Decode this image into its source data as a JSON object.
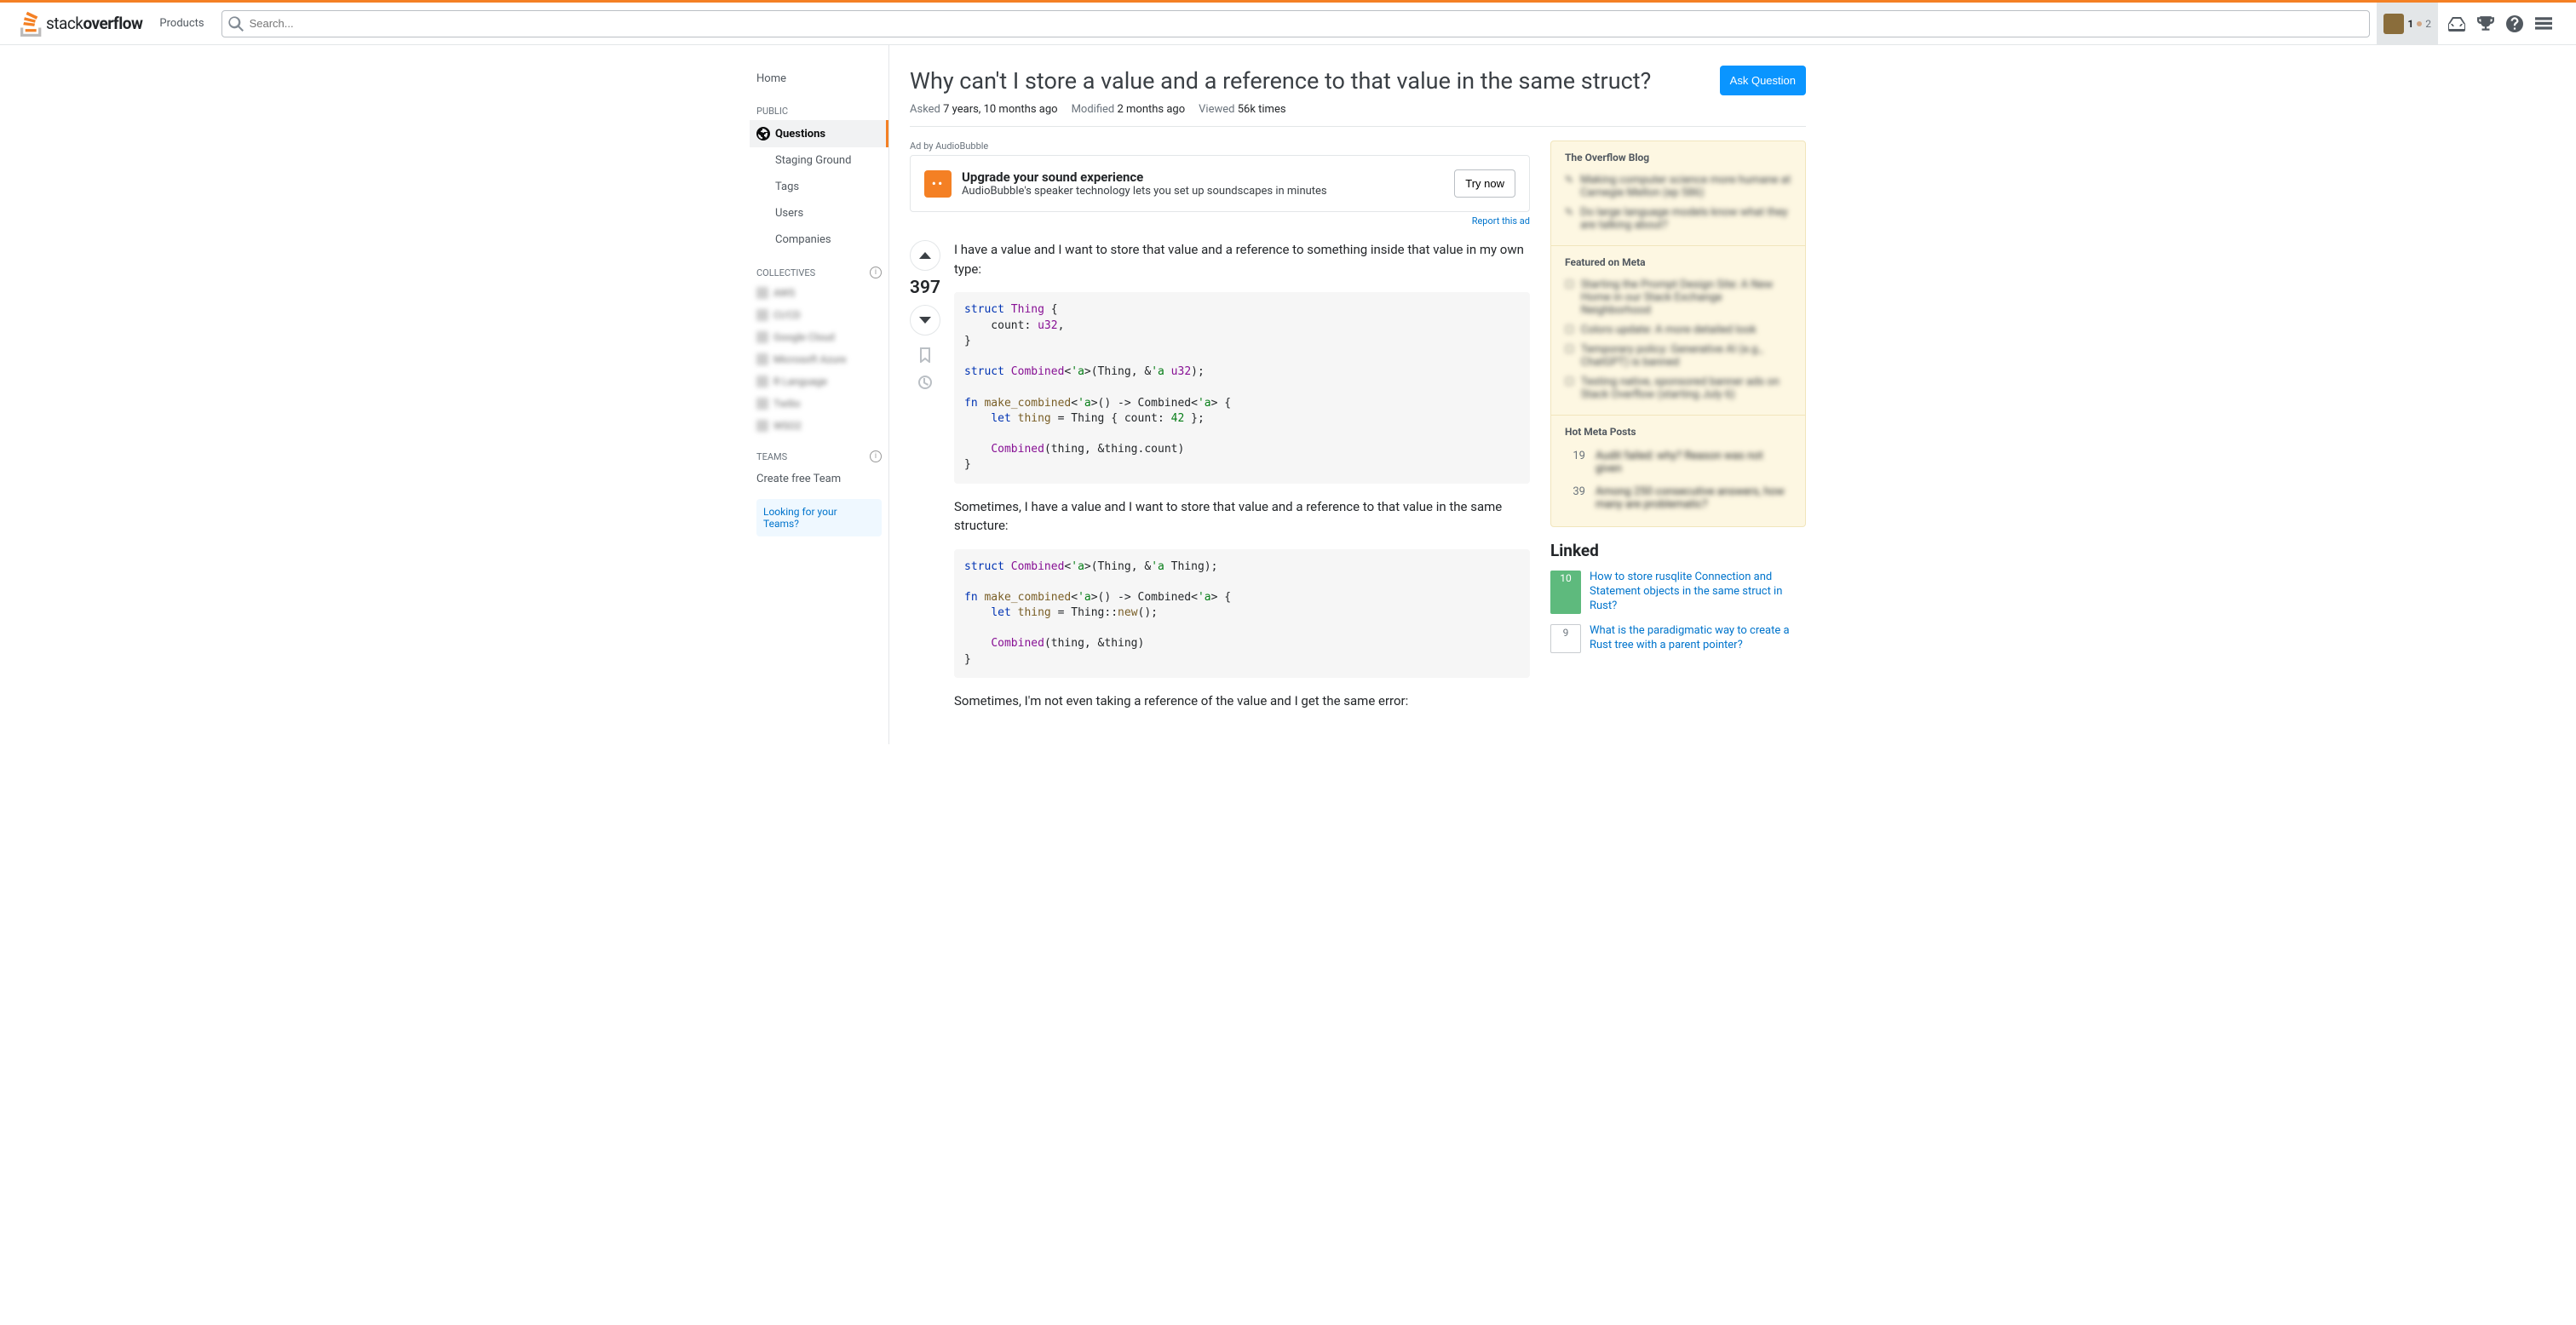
{
  "topbar": {
    "products": "Products",
    "search_placeholder": "Search...",
    "rep": "1",
    "bronze": "2"
  },
  "leftnav": {
    "home": "Home",
    "public": "PUBLIC",
    "questions": "Questions",
    "staging": "Staging Ground",
    "tags": "Tags",
    "users": "Users",
    "companies": "Companies",
    "collectives": "COLLECTIVES",
    "teams": "TEAMS",
    "create_team": "Create free Team",
    "looking": "Looking for your Teams?"
  },
  "question": {
    "title": "Why can't I store a value and a reference to that value in the same struct?",
    "ask_btn": "Ask Question",
    "asked_label": "Asked",
    "asked_val": "7 years, 10 months ago",
    "modified_label": "Modified",
    "modified_val": "2 months ago",
    "viewed_label": "Viewed",
    "viewed_val": "56k times",
    "score": "397"
  },
  "ad": {
    "label": "Ad by AudioBubble",
    "title": "Upgrade your sound experience",
    "sub": "AudioBubble's speaker technology lets you set up soundscapes in minutes",
    "cta": "Try now",
    "report": "Report this ad"
  },
  "body": {
    "p1": "I have a value and I want to store that value and a reference to something inside that value in my own type:",
    "p2": "Sometimes, I have a value and I want to store that value and a reference to that value in the same structure:",
    "p3": "Sometimes, I'm not even taking a reference of the value and I get the same error:"
  },
  "sidebar": {
    "blog_title": "The Overflow Blog",
    "meta_title": "Featured on Meta",
    "hot_title": "Hot Meta Posts",
    "hot1_num": "19",
    "hot2_num": "39",
    "linked_title": "Linked",
    "linked1_score": "10",
    "linked1_text": "How to store rusqlite Connection and Statement objects in the same struct in Rust?",
    "linked2_score": "9",
    "linked2_text": "What is the paradigmatic way to create a Rust tree with a parent pointer?"
  }
}
